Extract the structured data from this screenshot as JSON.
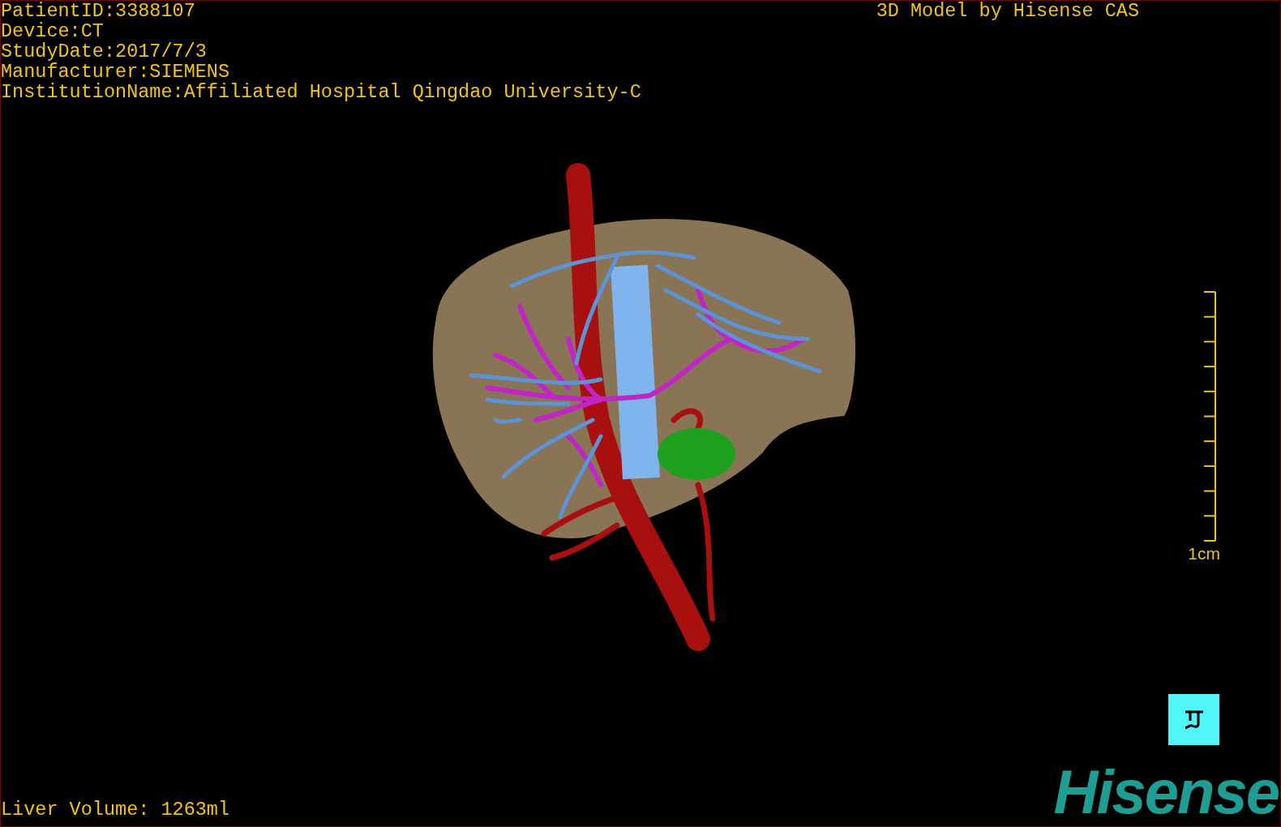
{
  "header": {
    "info": [
      "PatientID:3388107",
      "Device:CT",
      "StudyDate:2017/7/3",
      "Manufacturer:SIEMENS",
      "InstitutionName:Affiliated Hospital Qingdao University-C"
    ],
    "title": "3D Model by Hisense CAS"
  },
  "scale_bar": {
    "label": "1cm"
  },
  "footer": {
    "liver_volume": "Liver Volume: 1263ml",
    "logo": "Hisense"
  }
}
